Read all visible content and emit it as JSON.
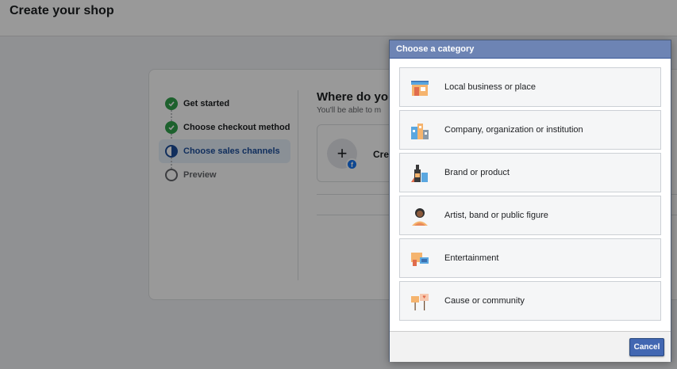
{
  "page": {
    "title": "Create your shop"
  },
  "steps": [
    {
      "label": "Get started",
      "status": "done"
    },
    {
      "label": "Choose checkout method",
      "status": "done"
    },
    {
      "label": "Choose sales channels",
      "status": "active"
    },
    {
      "label": "Preview",
      "status": "todo"
    }
  ],
  "main": {
    "heading": "Where do you",
    "subtext": "You'll be able to m",
    "create_label": "Cre"
  },
  "dialog": {
    "title": "Choose a category",
    "categories": [
      {
        "label": "Local business or place",
        "icon": "storefront-icon"
      },
      {
        "label": "Company, organization or institution",
        "icon": "buildings-icon"
      },
      {
        "label": "Brand or product",
        "icon": "product-bottle-icon"
      },
      {
        "label": "Artist, band or public figure",
        "icon": "artist-person-icon"
      },
      {
        "label": "Entertainment",
        "icon": "entertainment-tickets-icon"
      },
      {
        "label": "Cause or community",
        "icon": "protest-signs-icon"
      }
    ],
    "cancel_label": "Cancel"
  },
  "colors": {
    "header_bg": "#6d84b4",
    "button_bg": "#4267b2",
    "done_green": "#31a24c",
    "active_blue": "#1b4e9b"
  }
}
